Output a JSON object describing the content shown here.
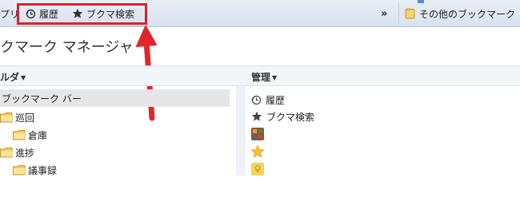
{
  "bookmark_bar": {
    "apps_label": "プリ",
    "history_label": "履歴",
    "star_label": "ブクマ検索",
    "more_chevron": "»",
    "other_label": "その他のブックマーク"
  },
  "page": {
    "title": "クマーク マネージャ"
  },
  "folders_panel": {
    "header": "ルダ",
    "root": "ブックマーク バー",
    "folders": [
      {
        "label": "巡回"
      },
      {
        "label": "倉庫"
      },
      {
        "label": "進捗"
      },
      {
        "label": "議事録"
      }
    ]
  },
  "manage_panel": {
    "header": "管理",
    "items": [
      {
        "label": "履歴",
        "icon": "history-icon"
      },
      {
        "label": "ブクマ検索",
        "icon": "star-icon"
      },
      {
        "label": "",
        "icon": "app-favicon"
      },
      {
        "label": "",
        "icon": "star-favicon"
      },
      {
        "label": "",
        "icon": "map-favicon"
      }
    ]
  },
  "colors": {
    "highlight": "#d9232a",
    "folder": "#f3c752",
    "bar_top": "#e9eef6",
    "bar_bottom": "#d9e2ef"
  }
}
